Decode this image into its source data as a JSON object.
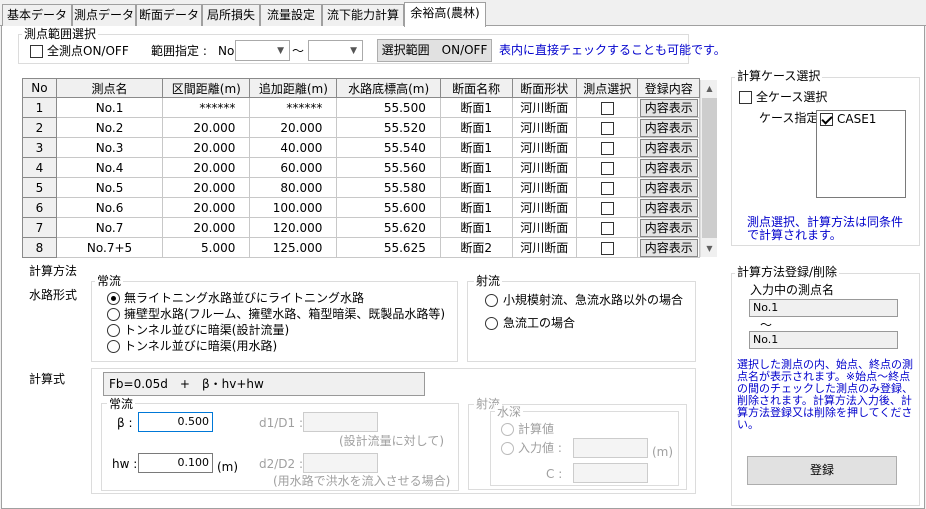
{
  "tabs": [
    "基本データ",
    "測点データ",
    "断面データ",
    "局所損失",
    "流量設定",
    "流下能力計算",
    "余裕高(農林)"
  ],
  "range": {
    "group_title": "測点範囲選択",
    "all_points_label": "全測点ON/OFF",
    "range_label": "範囲指定 :",
    "no_label": "No",
    "tilde": "〜",
    "range_button": "選択範囲　ON/OFF",
    "hint": "表内に直接チェックすることも可能です。"
  },
  "table": {
    "headers": [
      "No",
      "測点名",
      "区間距離(m)",
      "追加距離(m)",
      "水路底標高(m)",
      "断面名称",
      "断面形状",
      "測点選択",
      "登録内容"
    ],
    "rows": [
      {
        "no": "1",
        "name": "No.1",
        "dist": "******",
        "add": "******",
        "elev": "55.500",
        "section": "断面1",
        "shape": "河川断面",
        "btn": "内容表示"
      },
      {
        "no": "2",
        "name": "No.2",
        "dist": "20.000",
        "add": "20.000",
        "elev": "55.520",
        "section": "断面1",
        "shape": "河川断面",
        "btn": "内容表示"
      },
      {
        "no": "3",
        "name": "No.3",
        "dist": "20.000",
        "add": "40.000",
        "elev": "55.540",
        "section": "断面1",
        "shape": "河川断面",
        "btn": "内容表示"
      },
      {
        "no": "4",
        "name": "No.4",
        "dist": "20.000",
        "add": "60.000",
        "elev": "55.560",
        "section": "断面1",
        "shape": "河川断面",
        "btn": "内容表示"
      },
      {
        "no": "5",
        "name": "No.5",
        "dist": "20.000",
        "add": "80.000",
        "elev": "55.580",
        "section": "断面1",
        "shape": "河川断面",
        "btn": "内容表示"
      },
      {
        "no": "6",
        "name": "No.6",
        "dist": "20.000",
        "add": "100.000",
        "elev": "55.600",
        "section": "断面1",
        "shape": "河川断面",
        "btn": "内容表示"
      },
      {
        "no": "7",
        "name": "No.7",
        "dist": "20.000",
        "add": "120.000",
        "elev": "55.620",
        "section": "断面1",
        "shape": "河川断面",
        "btn": "内容表示"
      },
      {
        "no": "8",
        "name": "No.7+5",
        "dist": "5.000",
        "add": "125.000",
        "elev": "55.625",
        "section": "断面2",
        "shape": "河川断面",
        "btn": "内容表示"
      }
    ]
  },
  "case": {
    "group_title": "計算ケース選択",
    "all_cases_label": "全ケース選択",
    "case_label": "ケース指定",
    "cases": [
      "CASE1"
    ],
    "note": "測点選択、計算方法は同条件で計算されます。"
  },
  "method": {
    "group_title": "計算方法",
    "channel_type_label": "水路形式",
    "normal_flow_title": "常流",
    "normal_options": [
      "無ライトニング水路並びにライトニング水路",
      "擁壁型水路(フルーム、擁壁水路、箱型暗渠、既製品水路等)",
      "トンネル並びに暗渠(設計流量)",
      "トンネル並びに暗渠(用水路)"
    ],
    "jet_flow_title": "射流",
    "jet_options": [
      "小規模射流、急流水路以外の場合",
      "急流工の場合"
    ],
    "formula_label": "計算式",
    "formula": "Fb=0.05d　+　β・hv+hw",
    "calc_normal_title": "常流",
    "beta_label": "β :",
    "beta_value": "0.500",
    "hw_label": "hw :",
    "hw_value": "0.100",
    "hw_unit": "(m)",
    "d1d1_label": "d1/D1 :",
    "d1d1_note": "(設計流量に対して)",
    "d2d2_label": "d2/D2 :",
    "d2d2_note": "(用水路で洪水を流入させる場合)",
    "calc_jet_title": "射流",
    "water_depth_title": "水深",
    "calc_value_label": "計算値",
    "input_value_label": "入力値 :",
    "input_unit": "(m)",
    "c_label": "C :"
  },
  "register": {
    "group_title": "計算方法登録/削除",
    "current_label": "入力中の測点名",
    "start_point": "No.1",
    "tilde": "〜",
    "end_point": "No.1",
    "note": "選択した測点の内、始点、終点の測点名が表示されます。※始点〜終点の間のチェックした測点のみ登録、削除されます。計算方法入力後、計算方法登録又は削除を押してください。",
    "register_button": "登録"
  }
}
